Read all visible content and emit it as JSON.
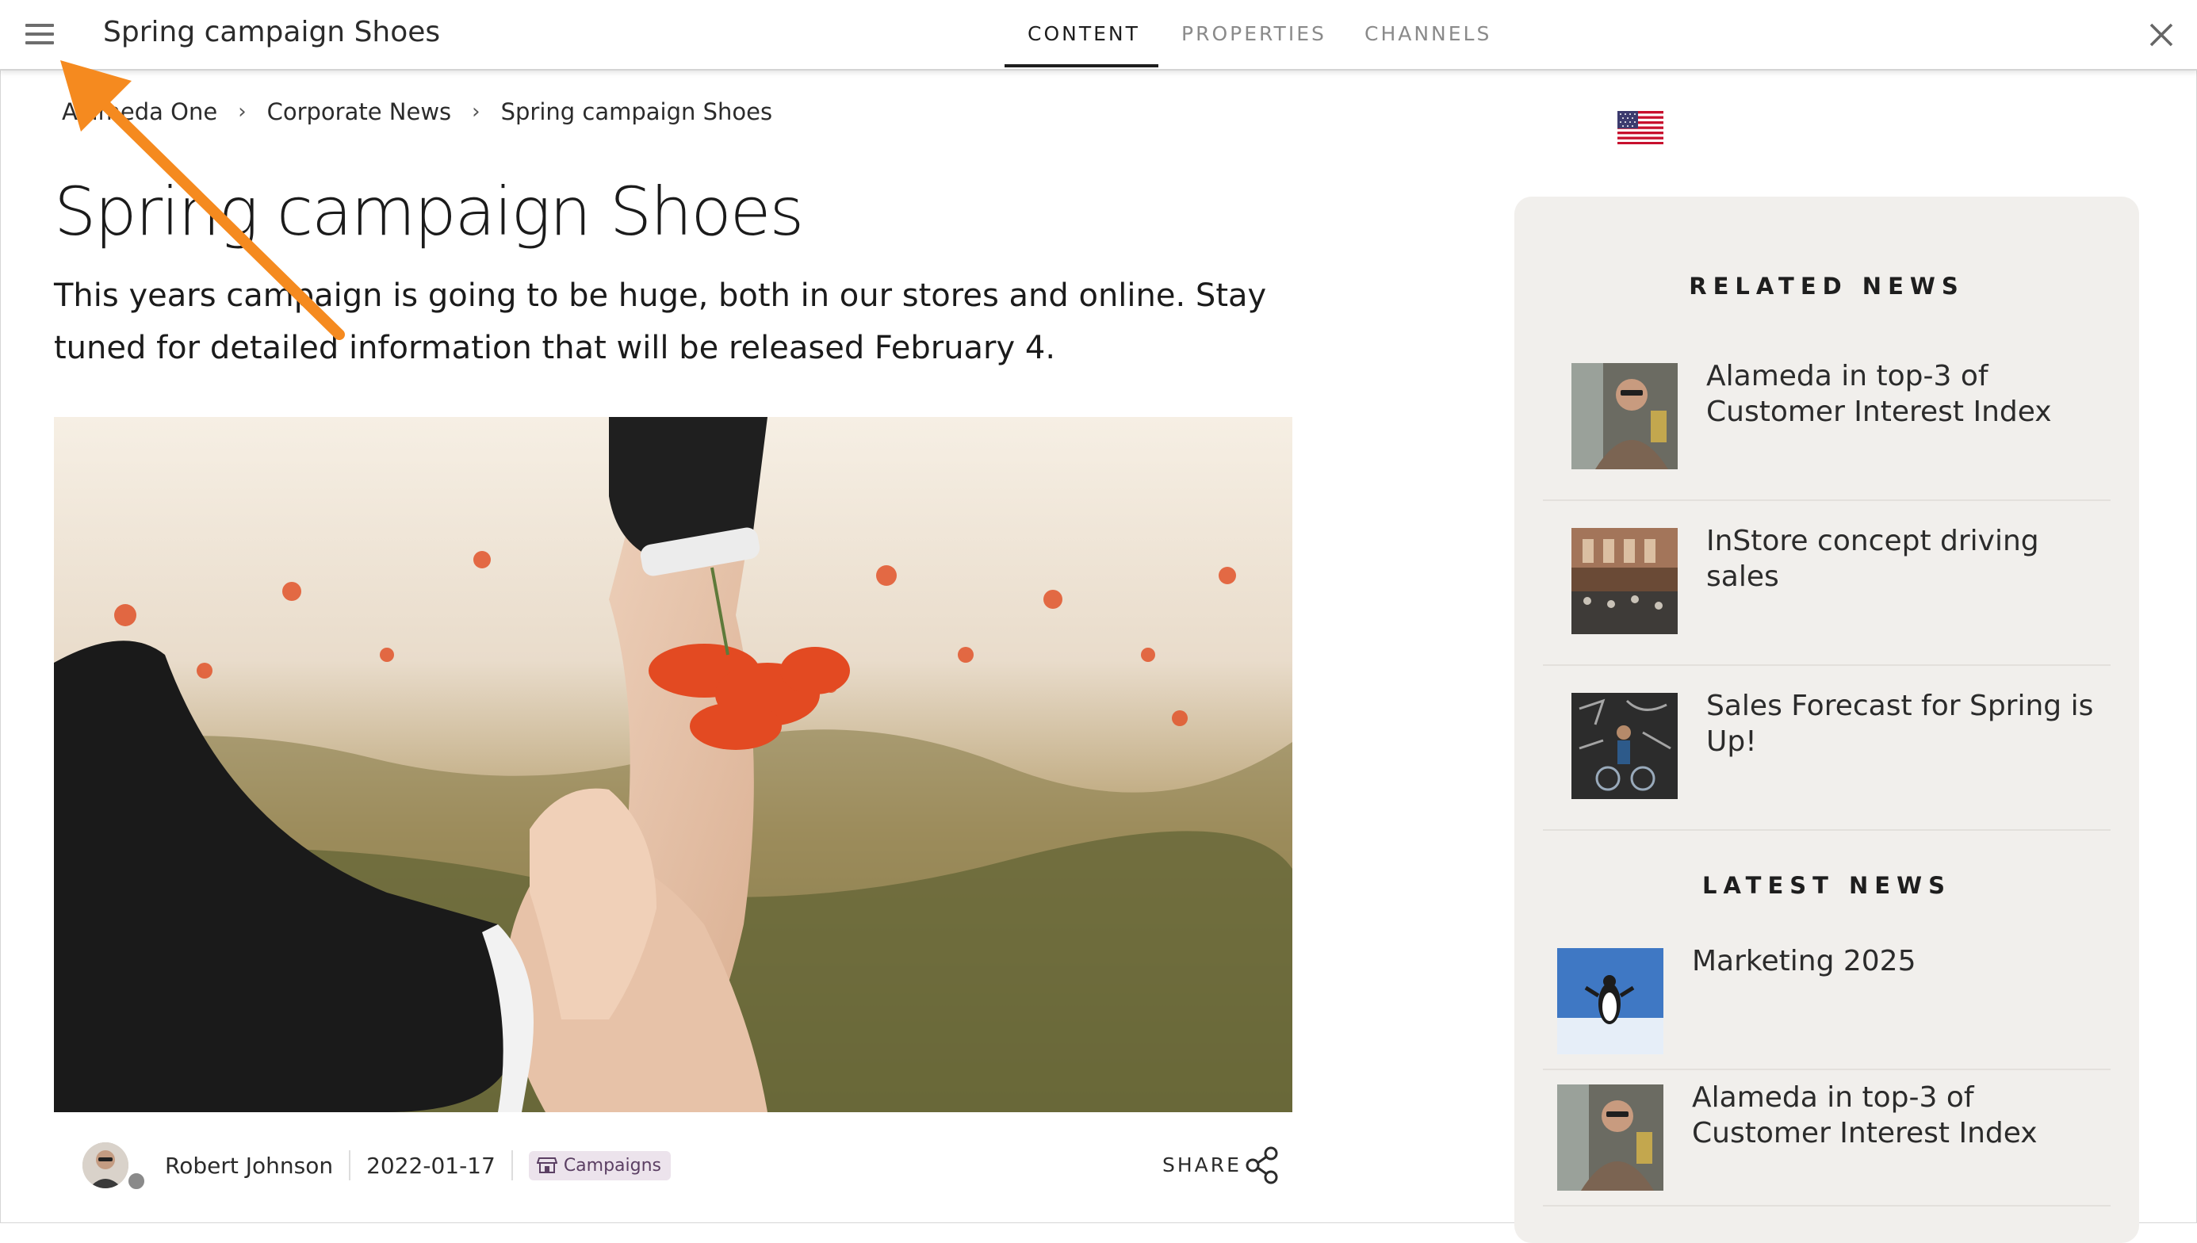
{
  "header": {
    "title": "Spring campaign Shoes",
    "tabs": [
      {
        "label": "CONTENT",
        "active": true
      },
      {
        "label": "PROPERTIES",
        "active": false
      },
      {
        "label": "CHANNELS",
        "active": false
      }
    ],
    "icons": {
      "menu": "hamburger-menu-icon",
      "close": "close-icon"
    }
  },
  "breadcrumb": [
    "Alameda One",
    "Corporate News",
    "Spring campaign Shoes"
  ],
  "article": {
    "title": "Spring campaign Shoes",
    "lead": "This years campaign is going to be huge, both in our stores and online. Stay tuned for detailed information that will be released February 4.",
    "author": "Robert Johnson",
    "date": "2022-01-17",
    "tag": "Campaigns",
    "share_label": "SHARE",
    "language_flag": "us-flag-icon"
  },
  "sidebar": {
    "related_heading": "RELATED NEWS",
    "related": [
      {
        "title": "Alameda in top-3 of Customer Interest Index"
      },
      {
        "title": "InStore concept driving sales"
      },
      {
        "title": "Sales Forecast for Spring is Up!"
      }
    ],
    "latest_heading": "LATEST NEWS",
    "latest": [
      {
        "title": "Marketing 2025"
      },
      {
        "title": "Alameda in top-3 of Customer Interest Index"
      }
    ]
  },
  "colors": {
    "annotation_arrow": "#f58a1f",
    "sidebar_bg": "#f1efec",
    "tag_bg": "#ece3ec"
  }
}
